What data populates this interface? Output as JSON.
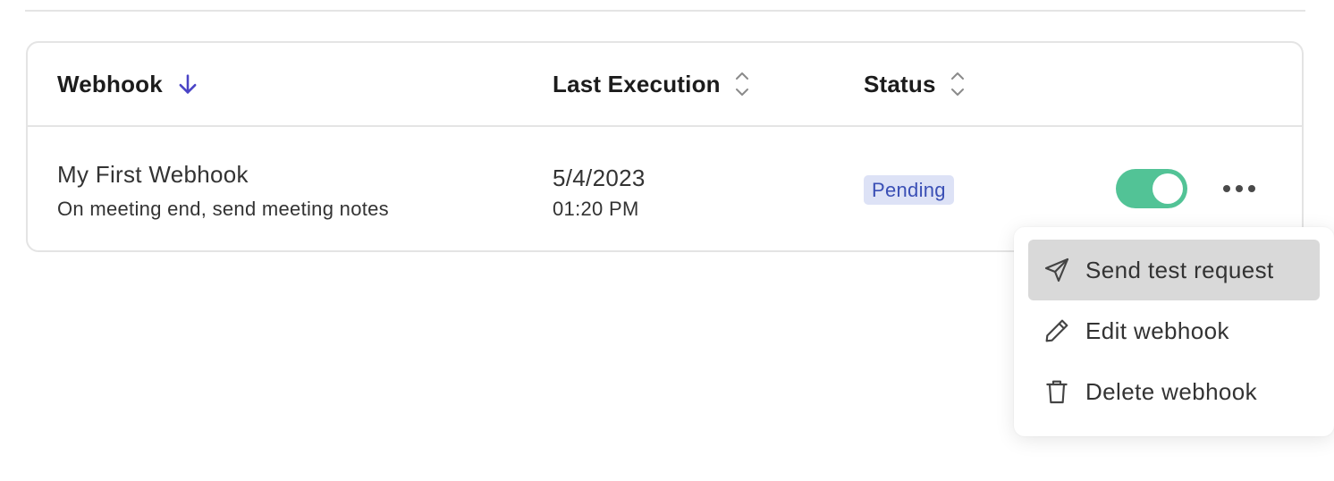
{
  "table": {
    "headers": {
      "webhook": "Webhook",
      "last_execution": "Last Execution",
      "status": "Status"
    },
    "sort": {
      "column": "webhook",
      "direction": "descending",
      "active_color": "#4a44c6"
    },
    "rows": [
      {
        "name": "My First Webhook",
        "description": "On meeting end, send meeting notes",
        "date": "5/4/2023",
        "time": "01:20 PM",
        "status": "Pending",
        "status_color": "#3a4fb5",
        "status_bg": "#dde2f6",
        "enabled": true,
        "toggle_color": "#52c396"
      }
    ]
  },
  "actions_menu": {
    "items": [
      {
        "label": "Send test request",
        "icon": "send-icon",
        "highlighted": true
      },
      {
        "label": "Edit webhook",
        "icon": "pencil-icon",
        "highlighted": false
      },
      {
        "label": "Delete webhook",
        "icon": "trash-icon",
        "highlighted": false
      }
    ]
  }
}
